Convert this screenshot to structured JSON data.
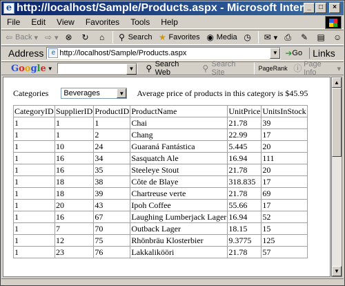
{
  "window": {
    "title": "http://localhost/Sample/Products.aspx - Microsoft Internet E..."
  },
  "menu": [
    "File",
    "Edit",
    "View",
    "Favorites",
    "Tools",
    "Help"
  ],
  "toolbar": {
    "back": "Back",
    "search": "Search",
    "favorites": "Favorites",
    "media": "Media"
  },
  "address": {
    "label": "Address",
    "url": "http://localhost/Sample/Products.aspx",
    "go": "Go",
    "links": "Links"
  },
  "google": {
    "search_web": "Search Web",
    "search_site": "Search Site",
    "pagerank": "PageRank",
    "page_info": "Page Info"
  },
  "page": {
    "categories_label": "Categories",
    "selected_category": "Beverages",
    "average_text": "Average price of products in this category is $45.95",
    "columns": [
      "CategoryID",
      "SupplierID",
      "ProductID",
      "ProductName",
      "UnitPrice",
      "UnitsInStock"
    ],
    "rows": [
      [
        "1",
        "1",
        "1",
        "Chai",
        "21.78",
        "39"
      ],
      [
        "1",
        "1",
        "2",
        "Chang",
        "22.99",
        "17"
      ],
      [
        "1",
        "10",
        "24",
        "Guaraná Fantástica",
        "5.445",
        "20"
      ],
      [
        "1",
        "16",
        "34",
        "Sasquatch Ale",
        "16.94",
        "111"
      ],
      [
        "1",
        "16",
        "35",
        "Steeleye Stout",
        "21.78",
        "20"
      ],
      [
        "1",
        "18",
        "38",
        "Côte de Blaye",
        "318.835",
        "17"
      ],
      [
        "1",
        "18",
        "39",
        "Chartreuse verte",
        "21.78",
        "69"
      ],
      [
        "1",
        "20",
        "43",
        "Ipoh Coffee",
        "55.66",
        "17"
      ],
      [
        "1",
        "16",
        "67",
        "Laughing Lumberjack Lager",
        "16.94",
        "52"
      ],
      [
        "1",
        "7",
        "70",
        "Outback Lager",
        "18.15",
        "15"
      ],
      [
        "1",
        "12",
        "75",
        "Rhönbräu Klosterbier",
        "9.3775",
        "125"
      ],
      [
        "1",
        "23",
        "76",
        "Lakkalikööri",
        "21.78",
        "57"
      ]
    ]
  }
}
